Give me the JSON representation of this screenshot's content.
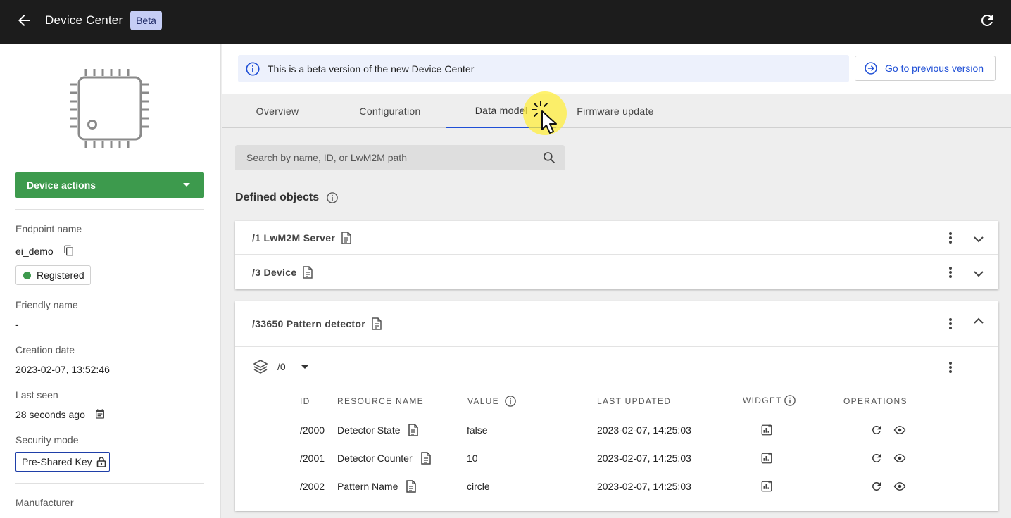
{
  "topbar": {
    "title": "Device Center",
    "badge": "Beta"
  },
  "sidebar": {
    "device_actions_label": "Device actions",
    "endpoint_label": "Endpoint name",
    "endpoint_value": "ei_demo",
    "status": "Registered",
    "friendly_label": "Friendly name",
    "friendly_value": "-",
    "creation_label": "Creation date",
    "creation_value": "2023-02-07, 13:52:46",
    "last_seen_label": "Last seen",
    "last_seen_value": "28 seconds ago",
    "security_label": "Security mode",
    "security_value": "Pre-Shared Key",
    "manufacturer_label": "Manufacturer"
  },
  "banner": {
    "text": "This is a beta version of the new Device Center",
    "prev_button": "Go to previous version"
  },
  "tabs": [
    {
      "label": "Overview"
    },
    {
      "label": "Configuration"
    },
    {
      "label": "Data model"
    },
    {
      "label": "Firmware update"
    }
  ],
  "search": {
    "placeholder": "Search by name, ID, or LwM2M path"
  },
  "defined_objects": {
    "title": "Defined objects",
    "objects": [
      {
        "label": "/1 LwM2M Server"
      },
      {
        "label": "/3 Device"
      },
      {
        "label": "/33650 Pattern detector"
      }
    ]
  },
  "instance": {
    "label": "/0"
  },
  "table": {
    "headers": {
      "id": "ID",
      "name": "RESOURCE NAME",
      "value": "VALUE",
      "updated": "LAST UPDATED",
      "widget": "WIDGET",
      "operations": "OPERATIONS"
    },
    "rows": [
      {
        "id": "/2000",
        "name": "Detector State",
        "value": "false",
        "updated": "2023-02-07, 14:25:03"
      },
      {
        "id": "/2001",
        "name": "Detector Counter",
        "value": "10",
        "updated": "2023-02-07, 14:25:03"
      },
      {
        "id": "/2002",
        "name": "Pattern Name",
        "value": "circle",
        "updated": "2023-02-07, 14:25:03"
      }
    ]
  },
  "colors": {
    "topbar": "#1c1c1c",
    "primary_green": "#3d9a4d",
    "accent_blue": "#1f4fd6",
    "cursor_highlight": "#ffee3c"
  }
}
